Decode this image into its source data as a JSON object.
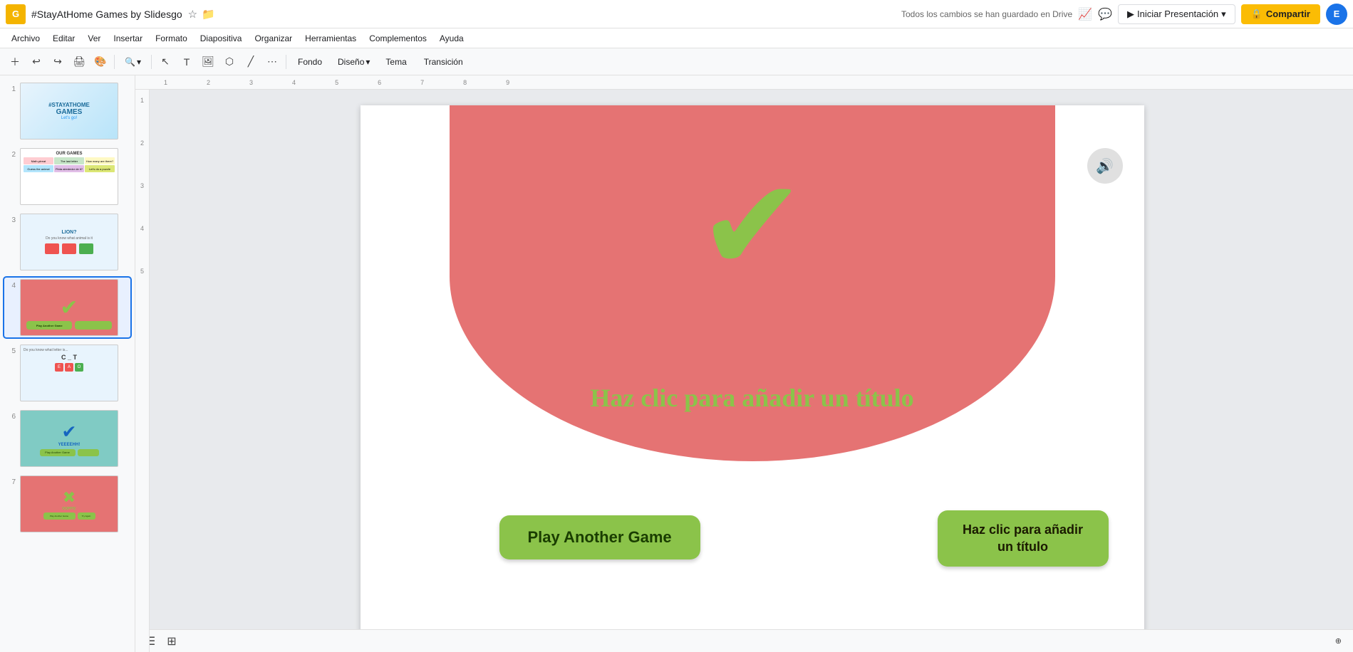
{
  "app": {
    "icon_label": "G",
    "title": "#StayAtHome Games by Slidesgo",
    "save_status": "Todos los cambios se han guardado en Drive"
  },
  "menu": {
    "items": [
      "Archivo",
      "Editar",
      "Ver",
      "Insertar",
      "Formato",
      "Diapositiva",
      "Organizar",
      "Herramientas",
      "Complementos",
      "Ayuda"
    ]
  },
  "toolbar": {
    "theme_btn": "Fondo",
    "design_btn": "Diseño",
    "theme_btn2": "Tema",
    "transition_btn": "Transición"
  },
  "topright": {
    "present_btn": "Iniciar Presentación",
    "share_btn": "Compartir",
    "avatar_label": "E"
  },
  "slides": [
    {
      "num": "1",
      "type": "thumb1"
    },
    {
      "num": "2",
      "type": "thumb2"
    },
    {
      "num": "3",
      "type": "thumb3"
    },
    {
      "num": "4",
      "type": "thumb4",
      "active": true
    },
    {
      "num": "5",
      "type": "thumb5"
    },
    {
      "num": "6",
      "type": "thumb6"
    },
    {
      "num": "7",
      "type": "thumb7"
    }
  ],
  "main_slide": {
    "title_placeholder": "Haz clic para añadir un título",
    "title_placeholder2": "Haz clic para añadir un título",
    "play_btn": "Play Another Game",
    "checkmark": "✔"
  }
}
